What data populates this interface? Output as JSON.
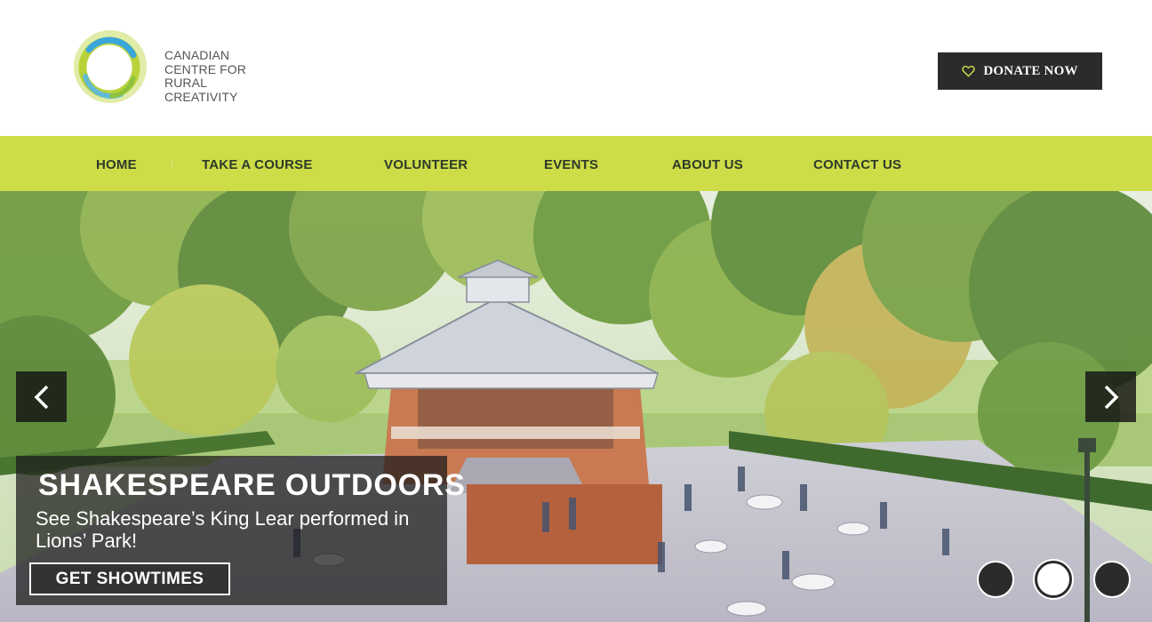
{
  "brand": {
    "name_lines": [
      "CANADIAN",
      "CENTRE FOR",
      "RURAL CREATIVITY"
    ],
    "logo_icon": "ring-logo-icon",
    "colors": {
      "green": "#b6cf2f",
      "blue": "#3aa6dc",
      "lime": "#cddc47"
    }
  },
  "header": {
    "donate_label": "DONATE NOW",
    "donate_icon": "heart-icon",
    "donate_bg": "#2b2b2b"
  },
  "nav": {
    "bg": "#cddc47",
    "items": [
      {
        "label": "HOME"
      },
      {
        "label": "TAKE A COURSE"
      },
      {
        "label": "VOLUNTEER"
      },
      {
        "label": "EVENTS"
      },
      {
        "label": "ABOUT US"
      },
      {
        "label": "CONTACT US"
      }
    ]
  },
  "hero": {
    "title": "SHAKESPEARE OUTDOORS",
    "text": "See Shakespeare’s King Lear performed in Lions’ Park!",
    "button_label": "GET SHOWTIMES",
    "prev_icon": "chevron-left-icon",
    "next_icon": "chevron-right-icon",
    "slide_count": 3,
    "active_slide": 2
  }
}
